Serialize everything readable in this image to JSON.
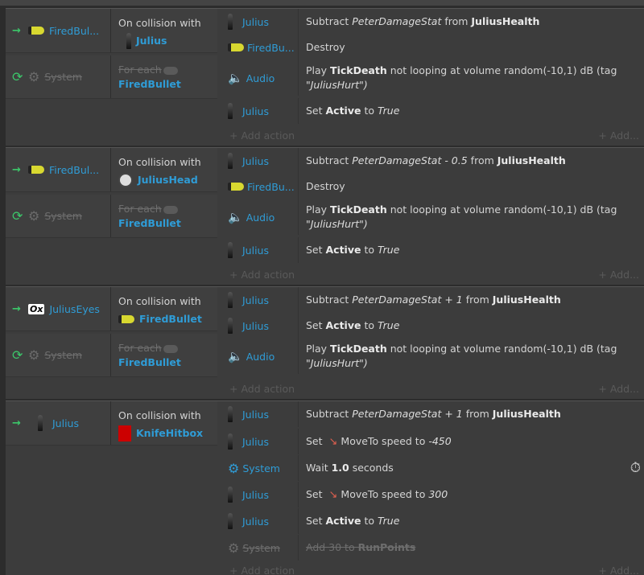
{
  "colors": {
    "accent": "#2f9cd6",
    "green": "#3cc76a",
    "moveto": "#e0604f",
    "hitbox": "#cc0000"
  },
  "labels": {
    "on_collision": "On collision with",
    "for_each": "For each",
    "system": "System",
    "add_action": "+ Add action",
    "add": "+ Add..."
  },
  "events": [
    {
      "trigger_object": "FiredBul...",
      "collide_target": "Julius",
      "for_each_target": "FiredBullet",
      "actions": [
        {
          "obj": "Julius",
          "parts": [
            "Subtract ",
            "PeterDamageStat",
            " from ",
            "JuliusHealth"
          ]
        },
        {
          "obj": "FiredBu...",
          "text": "Destroy"
        },
        {
          "obj": "Audio",
          "parts": [
            "Play ",
            "TickDeath",
            " not looping at volume random(-10,1) dB (tag ",
            "\"JuliusHurt\")"
          ]
        },
        {
          "obj": "Julius",
          "parts": [
            "Set ",
            "Active",
            " to ",
            "True"
          ]
        }
      ]
    },
    {
      "trigger_object": "FiredBul...",
      "collide_target": "JuliusHead",
      "for_each_target": "FiredBullet",
      "actions": [
        {
          "obj": "Julius",
          "parts": [
            "Subtract ",
            "PeterDamageStat - 0.5",
            " from ",
            "JuliusHealth"
          ]
        },
        {
          "obj": "FiredBu...",
          "text": "Destroy"
        },
        {
          "obj": "Audio",
          "parts": [
            "Play ",
            "TickDeath",
            " not looping at volume random(-10,1) dB (tag ",
            "\"JuliusHurt\")"
          ]
        },
        {
          "obj": "Julius",
          "parts": [
            "Set ",
            "Active",
            " to ",
            "True"
          ]
        }
      ]
    },
    {
      "trigger_object": "JuliusEyes",
      "trigger_icon_text": "Ox",
      "collide_target": "FiredBullet",
      "for_each_target": "FiredBullet",
      "actions": [
        {
          "obj": "Julius",
          "parts": [
            "Subtract ",
            "PeterDamageStat + 1",
            " from ",
            "JuliusHealth"
          ]
        },
        {
          "obj": "Julius",
          "parts": [
            "Set ",
            "Active",
            " to ",
            "True"
          ]
        },
        {
          "obj": "Audio",
          "parts": [
            "Play ",
            "TickDeath",
            " not looping at volume random(-10,1) dB (tag ",
            "\"JuliusHurt\")"
          ]
        }
      ]
    },
    {
      "trigger_object": "Julius",
      "collide_target": "KnifeHitbox",
      "actions": [
        {
          "obj": "Julius",
          "parts": [
            "Subtract ",
            "PeterDamageStat + 1",
            " from ",
            "JuliusHealth"
          ]
        },
        {
          "obj": "Julius",
          "parts": [
            "Set ",
            "MoveTo speed to ",
            "-450"
          ]
        },
        {
          "obj": "System",
          "parts": [
            "Wait ",
            "1.0",
            " seconds"
          ]
        },
        {
          "obj": "Julius",
          "parts": [
            "Set ",
            "MoveTo speed to ",
            "300"
          ]
        },
        {
          "obj": "Julius",
          "parts": [
            "Set ",
            "Active",
            " to ",
            "True"
          ]
        },
        {
          "obj": "System",
          "parts": [
            "Add 30 to ",
            "RunPoints"
          ],
          "disabled": true
        }
      ]
    }
  ]
}
